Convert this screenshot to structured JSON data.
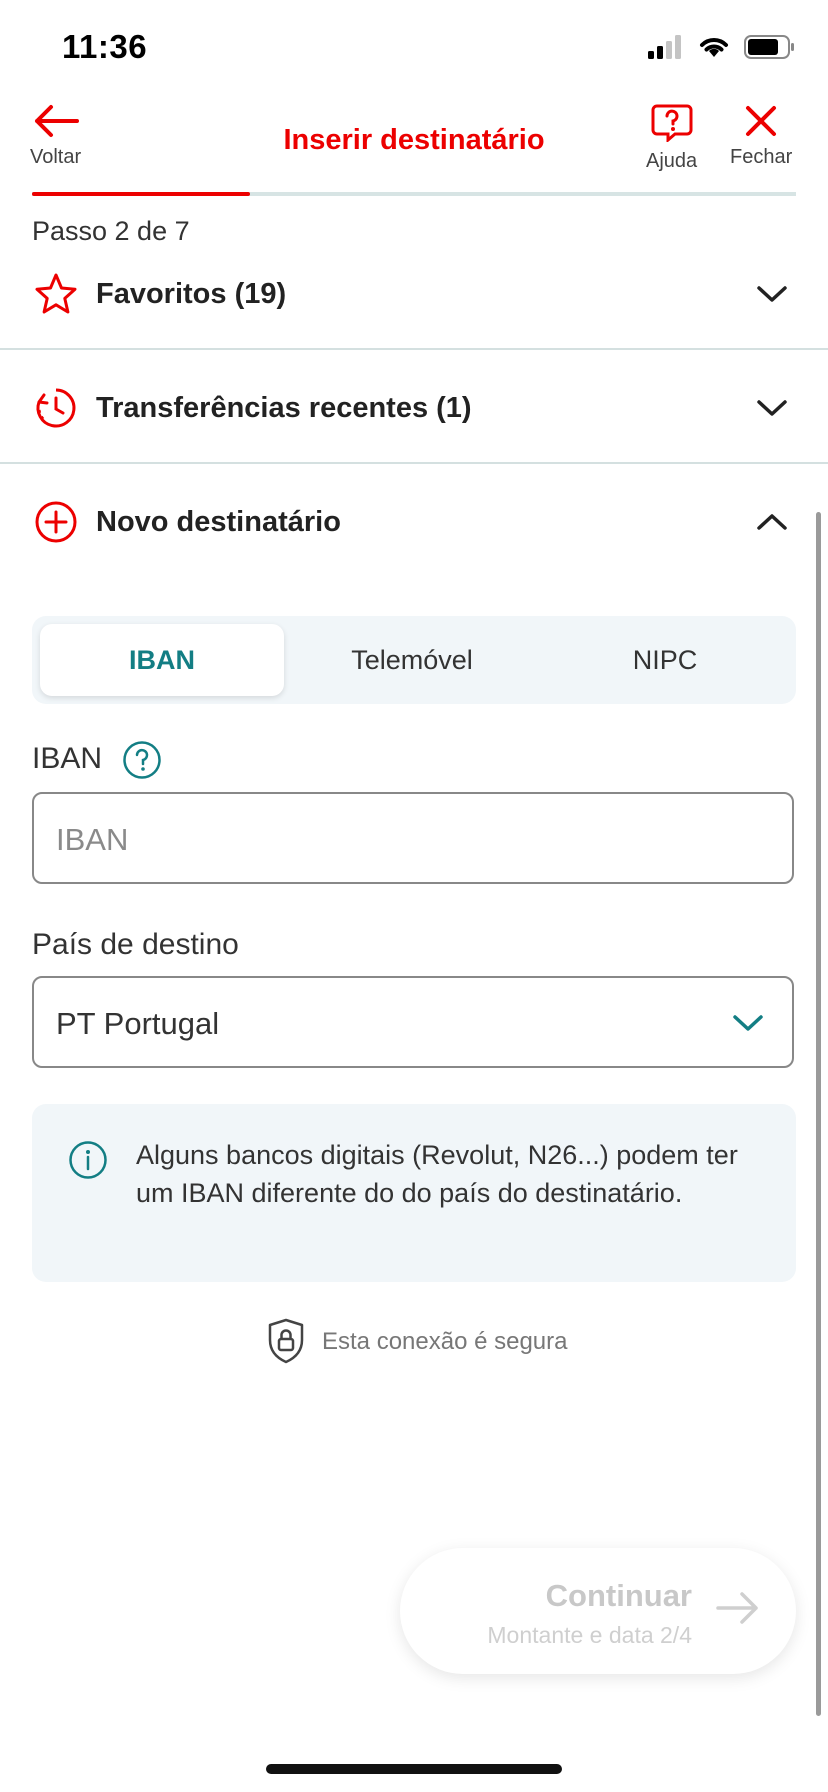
{
  "status_bar": {
    "time": "11:36"
  },
  "header": {
    "back_label": "Voltar",
    "title": "Inserir destinatário",
    "help_label": "Ajuda",
    "close_label": "Fechar",
    "progress_fraction": 0.2857
  },
  "step_text": "Passo 2 de 7",
  "accordion": {
    "favorites": "Favoritos (19)",
    "recent": "Transferências recentes (1)",
    "new_recipient": "Novo destinatário"
  },
  "tabs": [
    "IBAN",
    "Telemóvel",
    "NIPC"
  ],
  "form": {
    "iban_label": "IBAN",
    "iban_placeholder": "IBAN",
    "country_label": "País de destino",
    "country_value": "PT Portugal"
  },
  "info_text": "Alguns bancos digitais (Revolut, N26...) podem ter um IBAN diferente do do país do destinatário.",
  "secure_text": "Esta conexão é segura",
  "continue": {
    "label": "Continuar",
    "sublabel": "Montante e data 2/4"
  },
  "colors": {
    "accent": "#ec0000",
    "teal": "#137e84"
  }
}
